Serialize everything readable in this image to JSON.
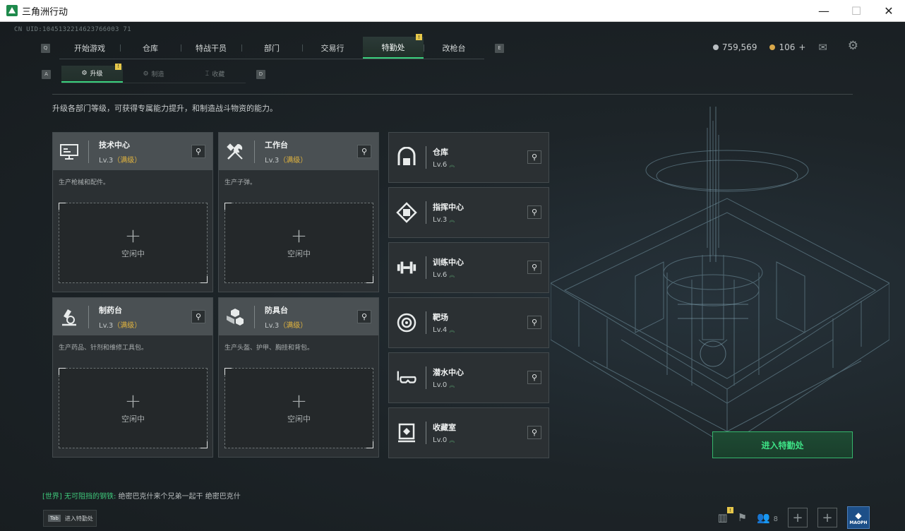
{
  "window": {
    "title": "三角洲行动",
    "minimize": "—",
    "maximize": "☐",
    "close": "✕"
  },
  "uid": "CN UID:1045132214623766003 71",
  "nav": {
    "left_key": "Q",
    "right_key": "E",
    "tabs": [
      "开始游戏",
      "仓库",
      "特战干员",
      "部门",
      "交易行",
      "特勤处",
      "改枪台"
    ],
    "active_index": 5,
    "badge": "!"
  },
  "subnav": {
    "left_key": "A",
    "right_key": "D",
    "tabs": [
      "升级",
      "制造",
      "收藏"
    ],
    "active_index": 0,
    "badge": "!"
  },
  "currency": {
    "silver": "759,569",
    "gold": "106",
    "gold_add": "+",
    "silver_color": "#b9bec2",
    "gold_color": "#d9a84a"
  },
  "description": "升级各部门等级，可获得专属能力提升，和制造战斗物资的能力。",
  "cards": [
    {
      "title": "技术中心",
      "level": "Lv.3",
      "max": "（满级）",
      "desc": "生产枪械和配件。",
      "plus": "+",
      "idle": "空闲中",
      "icon": "computer-icon"
    },
    {
      "title": "工作台",
      "level": "Lv.3",
      "max": "（满级）",
      "desc": "生产子弹。",
      "plus": "+",
      "idle": "空闲中",
      "icon": "tools-icon"
    },
    {
      "title": "制药台",
      "level": "Lv.3",
      "max": "（满级）",
      "desc": "生产药品、针剂和维修工具包。",
      "plus": "+",
      "idle": "空闲中",
      "icon": "microscope-icon"
    },
    {
      "title": "防具台",
      "level": "Lv.3",
      "max": "（满级）",
      "desc": "生产头盔、护甲、胸挂和背包。",
      "plus": "+",
      "idle": "空闲中",
      "icon": "armor-cubes-icon"
    }
  ],
  "facilities": [
    {
      "title": "仓库",
      "level": "Lv.6",
      "icon": "warehouse-icon"
    },
    {
      "title": "指挥中心",
      "level": "Lv.3",
      "icon": "command-chip-icon"
    },
    {
      "title": "训练中心",
      "level": "Lv.6",
      "icon": "dumbbell-icon"
    },
    {
      "title": "靶场",
      "level": "Lv.4",
      "icon": "target-icon"
    },
    {
      "title": "潜水中心",
      "level": "Lv.0",
      "icon": "diving-mask-icon"
    },
    {
      "title": "收藏室",
      "level": "Lv.0",
      "icon": "collection-icon"
    }
  ],
  "enter_button": "进入特勤处",
  "chat": {
    "channel": "[世界]",
    "name": "无可阻挡的钢铁:",
    "message": "绝密巴克什来个兄弟一起干 绝密巴克什"
  },
  "tab_hint": {
    "key": "Tab",
    "label": "进入特勤处"
  },
  "bottom": {
    "friends_count": "8",
    "badge": "!",
    "avatar_text": "MAOPH"
  }
}
